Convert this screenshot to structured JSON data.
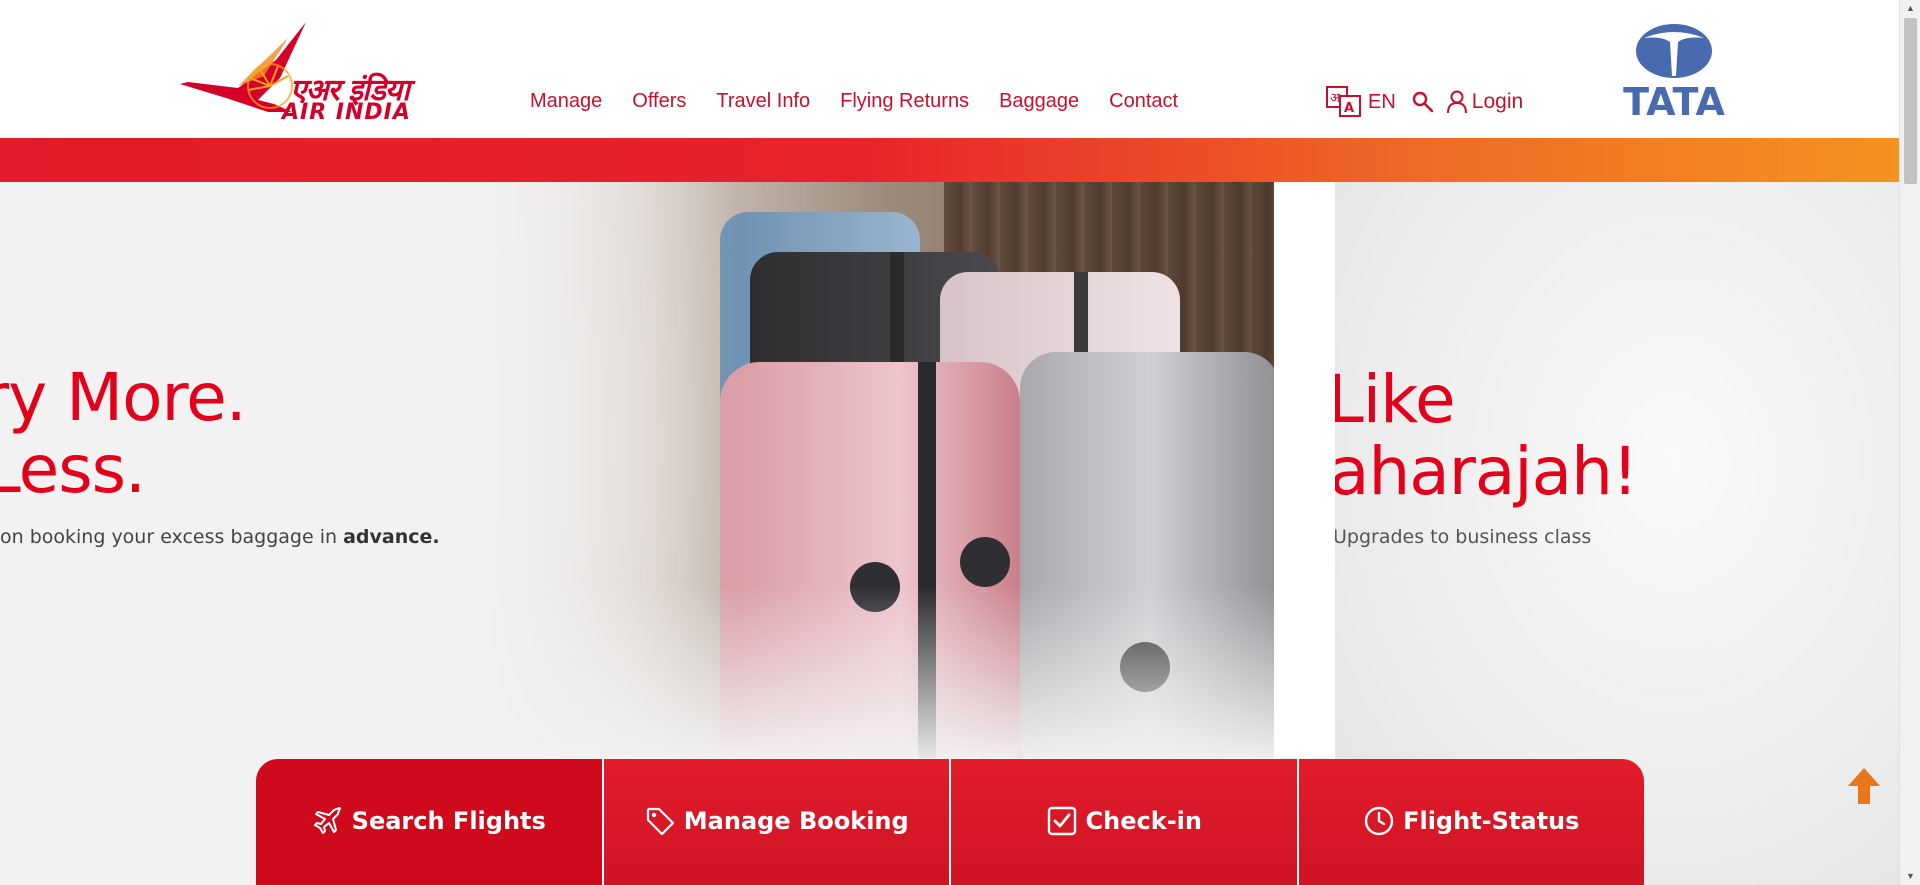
{
  "header": {
    "logo": {
      "hindi_text": "एअर इंडिया",
      "english_text": "AIR INDIA",
      "icon": "air-india-maharajah-wing-icon",
      "color": "#d4002a"
    },
    "nav": [
      {
        "label": "Manage"
      },
      {
        "label": "Offers"
      },
      {
        "label": "Travel Info"
      },
      {
        "label": "Flying Returns"
      },
      {
        "label": "Baggage"
      },
      {
        "label": "Contact"
      }
    ],
    "utilities": {
      "language_icon": "translate-icon",
      "language": "EN",
      "search_icon": "search-icon",
      "user_icon": "user-icon",
      "login_label": "Login"
    },
    "partner_logo": {
      "text": "TATA",
      "icon": "tata-emblem-icon",
      "color": "#486aaf"
    }
  },
  "band": {
    "colors": [
      "#e31b2a",
      "#f5931e"
    ]
  },
  "hero": {
    "slide_left": {
      "headline_line1": "ry More.",
      "headline_line2": "Less.",
      "subtext": "on booking your excess baggage in ",
      "subtext_bold": "advance."
    },
    "slide_right": {
      "headline_line1": "Like",
      "headline_line2": "aharajah!",
      "subtext": "Upgrades to business class"
    },
    "accent_color": "#e2001a"
  },
  "booking_tabs": [
    {
      "label": "Search Flights",
      "icon": "airplane-icon",
      "active": true
    },
    {
      "label": "Manage Booking",
      "icon": "tag-icon",
      "active": false
    },
    {
      "label": "Check-in",
      "icon": "checkbox-icon",
      "active": false
    },
    {
      "label": "Flight-Status",
      "icon": "clock-icon",
      "active": false
    }
  ],
  "scroll_top": {
    "icon": "arrow-up-icon",
    "color": "#e8761a"
  }
}
